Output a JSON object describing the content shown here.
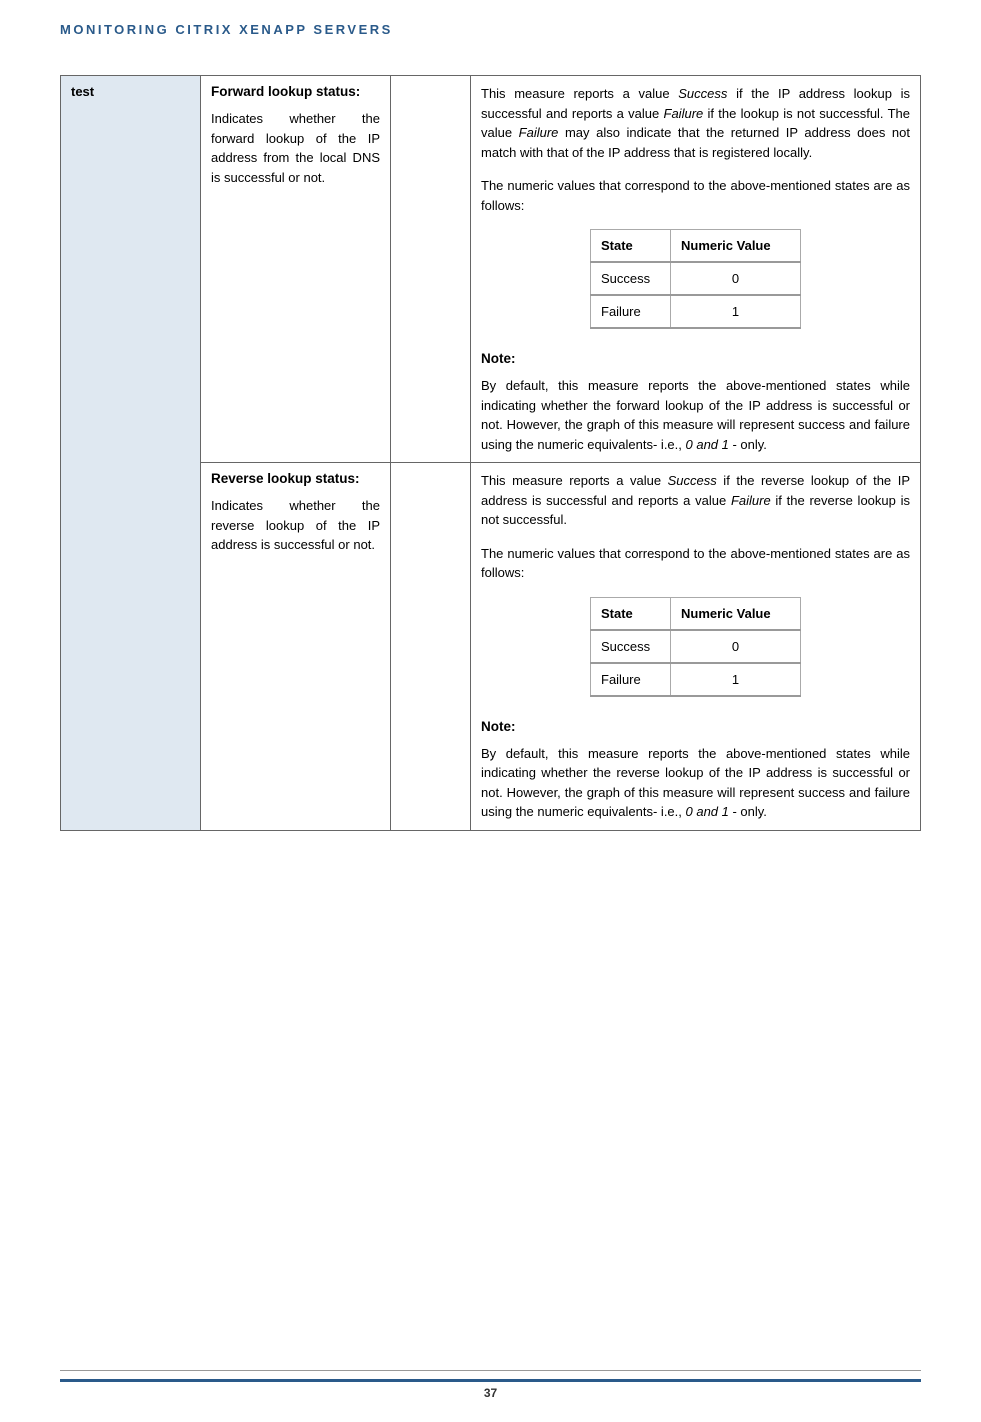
{
  "header": {
    "title": "MONITORING CITRIX XENAPP SERVERS"
  },
  "table": {
    "col1_label": "test",
    "rows": [
      {
        "measure_title": "Forward lookup status:",
        "measure_desc": "Indicates whether the forward lookup of the IP address from the local DNS is successful or not.",
        "detail_p1a": "This measure reports a value ",
        "detail_p1_success": "Success",
        "detail_p1b": " if the IP address lookup is successful and reports a value ",
        "detail_p1_failure": "Failure",
        "detail_p1c": " if the lookup is not successful. The value ",
        "detail_p1_failure2": "Failure",
        "detail_p1d": " may also indicate that the returned IP address does not match with that of the IP address that is registered locally.",
        "detail_p2": "The numeric values that correspond to the above-mentioned states are as follows:",
        "inner_table": {
          "header_state": "State",
          "header_value": "Numeric Value",
          "rows": [
            {
              "state": "Success",
              "value": "0"
            },
            {
              "state": "Failure",
              "value": "1"
            }
          ]
        },
        "note_label": "Note:",
        "note_a": "By default, this measure reports the above-mentioned states while indicating whether the forward lookup of the IP address is successful or not. However, the graph of this measure will represent success and failure using the numeric equivalents- i.e., ",
        "note_italic": "0 and 1",
        "note_b": " - only."
      },
      {
        "measure_title": "Reverse lookup status:",
        "measure_desc": "Indicates whether the reverse lookup of the IP address is successful or not.",
        "detail_p1a": "This measure reports a value ",
        "detail_p1_success": "Success",
        "detail_p1b": " if the reverse lookup of the IP address is successful and reports a value ",
        "detail_p1_failure": "Failure",
        "detail_p1c": " if the reverse lookup is not successful.",
        "detail_p2": "The numeric values that correspond to the above-mentioned states are as follows:",
        "inner_table": {
          "header_state": "State",
          "header_value": "Numeric Value",
          "rows": [
            {
              "state": "Success",
              "value": "0"
            },
            {
              "state": "Failure",
              "value": "1"
            }
          ]
        },
        "note_label": "Note:",
        "note_a": "By default, this measure reports the above-mentioned states while indicating whether the reverse lookup of the IP address is successful or not. However, the graph of this measure will represent success and failure using the numeric equivalents- i.e., ",
        "note_italic": "0 and 1",
        "note_b": " - only."
      }
    ]
  },
  "footer": {
    "page_number": "37"
  }
}
